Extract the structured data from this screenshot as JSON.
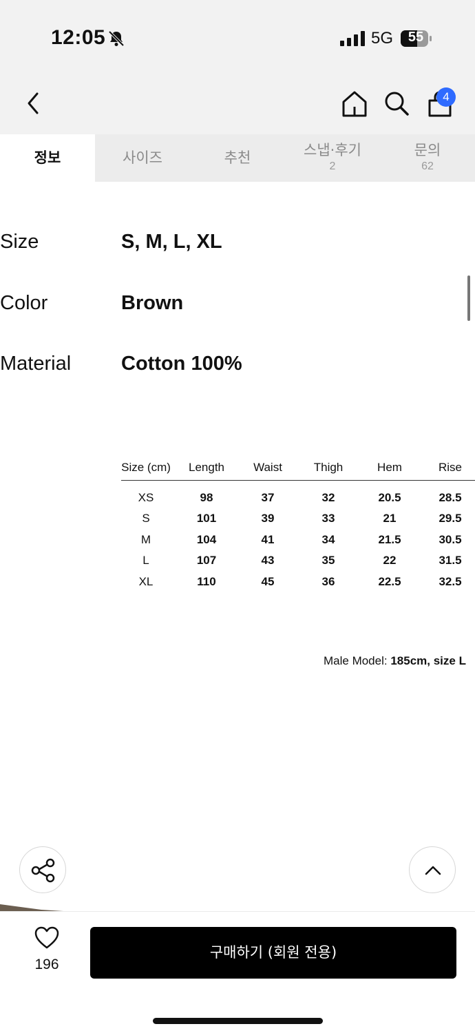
{
  "status_bar": {
    "time": "12:05",
    "network": "5G",
    "battery": "55"
  },
  "header": {
    "cart_badge": "4",
    "icons": [
      "chevron-left-icon",
      "home-icon",
      "search-icon",
      "shopping-bag-icon"
    ]
  },
  "tabs": [
    {
      "label": "정보",
      "count": "",
      "active": true
    },
    {
      "label": "사이즈",
      "count": ""
    },
    {
      "label": "추천",
      "count": ""
    },
    {
      "label": "스냅·후기",
      "count": "2"
    },
    {
      "label": "문의",
      "count": "62"
    }
  ],
  "specs": [
    {
      "label": "Size",
      "value": "S, M, L, XL"
    },
    {
      "label": "Color",
      "value": "Brown"
    },
    {
      "label": "Material",
      "value": "Cotton 100%"
    }
  ],
  "size_table": {
    "headers": [
      "Size (cm)",
      "Length",
      "Waist",
      "Thigh",
      "Hem",
      "Rise"
    ],
    "rows": [
      [
        "XS",
        "98",
        "37",
        "32",
        "20.5",
        "28.5"
      ],
      [
        "S",
        "101",
        "39",
        "33",
        "21",
        "29.5"
      ],
      [
        "M",
        "104",
        "41",
        "34",
        "21.5",
        "30.5"
      ],
      [
        "L",
        "107",
        "43",
        "35",
        "22",
        "31.5"
      ],
      [
        "XL",
        "110",
        "45",
        "36",
        "22.5",
        "32.5"
      ]
    ]
  },
  "model_note": {
    "prefix": "Male Model: ",
    "height": "185cm",
    "separator": ", ",
    "size": "size L"
  },
  "floating_buttons": {
    "share_icon": "share-icon",
    "top_icon": "chevron-up-icon"
  },
  "bottom_bar": {
    "like_count": "196",
    "buy_label": "구매하기 (회원 전용)"
  },
  "colors": {
    "badge": "#2f6bff",
    "buy_button": "#000000",
    "header_bg": "#f2f2f2",
    "tab_bg": "#ececec"
  }
}
